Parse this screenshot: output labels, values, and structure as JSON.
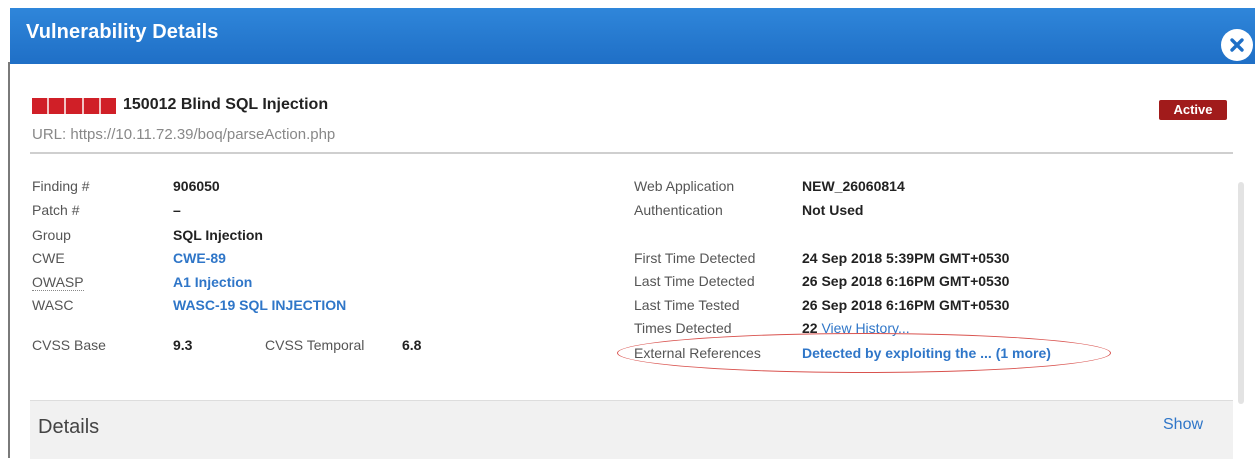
{
  "dialog": {
    "title": "Vulnerability Details",
    "close_icon": "close-icon"
  },
  "vulnerability": {
    "qid": "150012",
    "name": "Blind SQL Injection",
    "title": "150012 Blind SQL Injection",
    "severity_level": 5,
    "url_label": "URL:",
    "url": "https://10.11.72.39/boq/parseAction.php",
    "status": "Active"
  },
  "left_fields": {
    "finding_label": "Finding #",
    "finding_value": "906050",
    "patch_label": "Patch #",
    "patch_value": "–",
    "group_label": "Group",
    "group_value": "SQL Injection",
    "cwe_label": "CWE",
    "cwe_value": "CWE-89",
    "owasp_label": "OWASP",
    "owasp_value": "A1 Injection",
    "wasc_label": "WASC",
    "wasc_value": "WASC-19 SQL INJECTION",
    "cvss_base_label": "CVSS Base",
    "cvss_base_value": "9.3",
    "cvss_temporal_label": "CVSS Temporal",
    "cvss_temporal_value": "6.8"
  },
  "right_fields": {
    "webapp_label": "Web Application",
    "webapp_value": "NEW_26060814",
    "auth_label": "Authentication",
    "auth_value": "Not Used",
    "first_detected_label": "First Time Detected",
    "first_detected_value": "24 Sep 2018 5:39PM GMT+0530",
    "last_detected_label": "Last Time Detected",
    "last_detected_value": "26 Sep 2018 6:16PM GMT+0530",
    "last_tested_label": "Last Time Tested",
    "last_tested_value": "26 Sep 2018 6:16PM GMT+0530",
    "times_detected_label": "Times Detected",
    "times_detected_value": "22",
    "view_history_link": "View History...",
    "ext_refs_label": "External References",
    "ext_refs_value": "Detected by exploiting the ... (1 more)"
  },
  "details_section": {
    "title": "Details",
    "show_label": "Show"
  },
  "colors": {
    "header_blue": "#2579d0",
    "severity_red": "#d01f27",
    "status_red": "#a11b1b",
    "link_blue": "#2f76c8",
    "highlight_oval": "#d9534f"
  }
}
